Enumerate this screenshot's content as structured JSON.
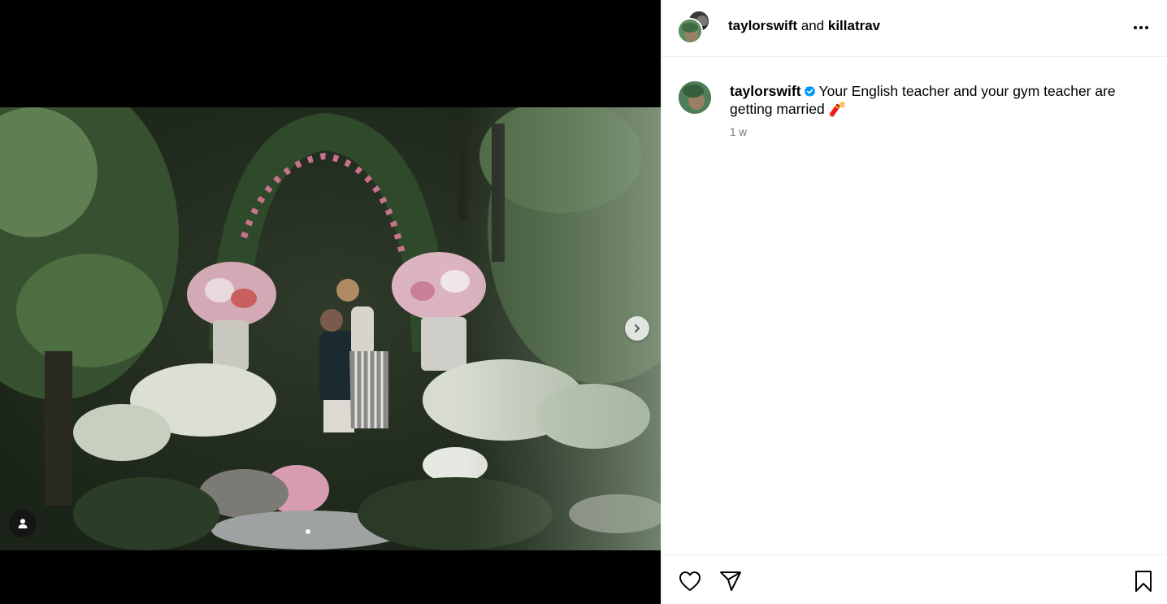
{
  "post": {
    "media": {
      "description_icons": {
        "next": "chevron-right-icon",
        "tag": "person-icon"
      },
      "carousel": {
        "count": 1,
        "active": 0
      }
    },
    "header": {
      "user1": "taylorswift",
      "connector": "and",
      "user2": "killatrav",
      "more_icon": "more-horizontal-icon"
    },
    "caption": {
      "username": "taylorswift",
      "verified": true,
      "text": "Your English teacher and your gym teacher are getting married",
      "emoji": "🧨",
      "time": "1 w"
    },
    "actions": {
      "like_icon": "heart-icon",
      "share_icon": "paper-plane-icon",
      "save_icon": "bookmark-icon"
    },
    "colors": {
      "verified_blue": "#0095f6",
      "divider": "#efefef",
      "muted_text": "#737373"
    }
  }
}
